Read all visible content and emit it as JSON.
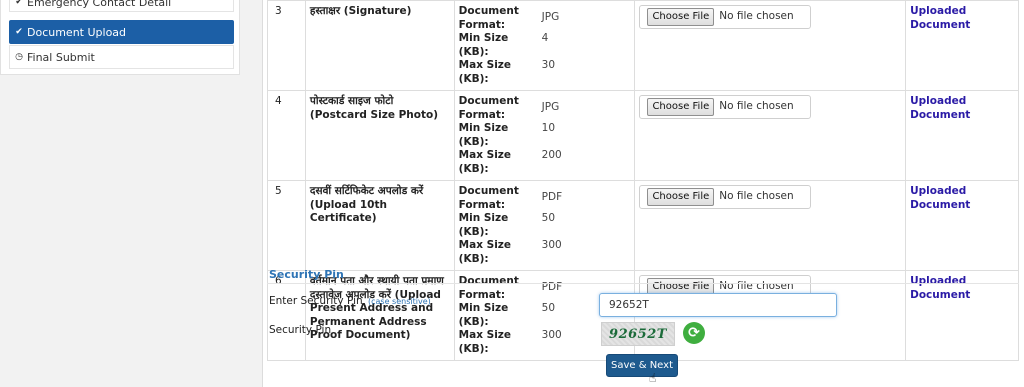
{
  "sidebar": {
    "items": [
      {
        "label": "Emergency Contact Detail",
        "icon": "check-circle-icon",
        "glyph": "✔"
      },
      {
        "label": "Document Upload",
        "icon": "check-circle-icon",
        "glyph": "✔"
      },
      {
        "label": "Final Submit",
        "icon": "clock-icon",
        "glyph": "◷"
      }
    ]
  },
  "documents": {
    "format_label": "Document Format:",
    "format_label_1": "Document",
    "format_label_2": "Format:",
    "min_label": "Min Size (KB):",
    "max_label": "Max Size (KB):",
    "choose_label": "Choose File",
    "no_file_label": "No file chosen",
    "status_label": "Uploaded Document",
    "rows": [
      {
        "no": "3",
        "name": "हस्ताक्षर (Signature)",
        "format": "JPG",
        "min": "4",
        "max": "30"
      },
      {
        "no": "4",
        "name": "पोस्टकार्ड साइज फोटो (Postcard Size Photo)",
        "format": "JPG",
        "min": "10",
        "max": "200"
      },
      {
        "no": "5",
        "name": "दसवीं सर्टिफिकेट अपलोड करें (Upload 10th Certificate)",
        "format": "PDF",
        "min": "50",
        "max": "300"
      },
      {
        "no": "6",
        "name": "वर्तमान पता और स्थायी पता प्रमाण दस्तावेज अपलोड करें (Upload Present Address and Permanent Address Proof Document)",
        "format": "PDF",
        "min": "50",
        "max": "300"
      }
    ]
  },
  "security": {
    "title": "Security Pin",
    "enter_label": "Enter Security Pin",
    "case_hint": "(case sensitive)",
    "input_value": "92652T",
    "pin_label": "Security Pin",
    "captcha_text": "92652T",
    "refresh_icon": "refresh-icon",
    "refresh_glyph": "⟳",
    "save_label": "Save & Next"
  },
  "colors": {
    "active_nav": "#1c5fa6",
    "link": "#2a1aa6",
    "section_title": "#2e74b5",
    "button": "#1e5a8e",
    "refresh": "#3fae3f"
  }
}
